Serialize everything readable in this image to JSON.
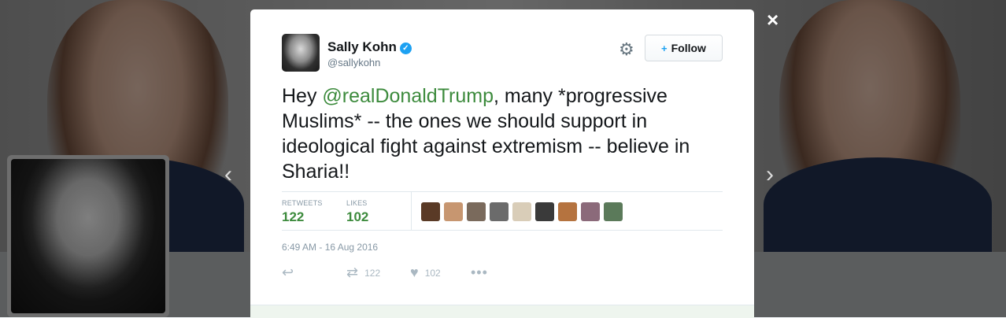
{
  "close_icon": "×",
  "nav": {
    "prev_icon": "‹",
    "next_icon": "›"
  },
  "tweet": {
    "author_name": "Sally Kohn",
    "verified_icon": "✓",
    "handle": "@sallykohn",
    "follow_label": "Follow",
    "follow_icon": "+",
    "gear_icon": "⚙",
    "text_prefix": "Hey ",
    "mention": "@realDonaldTrump",
    "text_rest": ", many *progressive Muslims* -- the ones we should support in ideological fight against extremism -- believe in Sharia!!",
    "stats": {
      "retweets_label": "RETWEETS",
      "retweets_value": "122",
      "likes_label": "LIKES",
      "likes_value": "102"
    },
    "likers": [
      "#5a3a26",
      "#c79670",
      "#7a6a5c",
      "#6b6b6b",
      "#d9cdb8",
      "#3a3a3a",
      "#b5733f",
      "#8b6a7a",
      "#5b7a5a"
    ],
    "timestamp": "6:49 AM - 16 Aug 2016",
    "actions": {
      "reply_icon": "↩",
      "retweet_icon": "⇄",
      "retweet_count": "122",
      "like_icon": "♥",
      "like_count": "102",
      "more_icon": "•••"
    }
  }
}
